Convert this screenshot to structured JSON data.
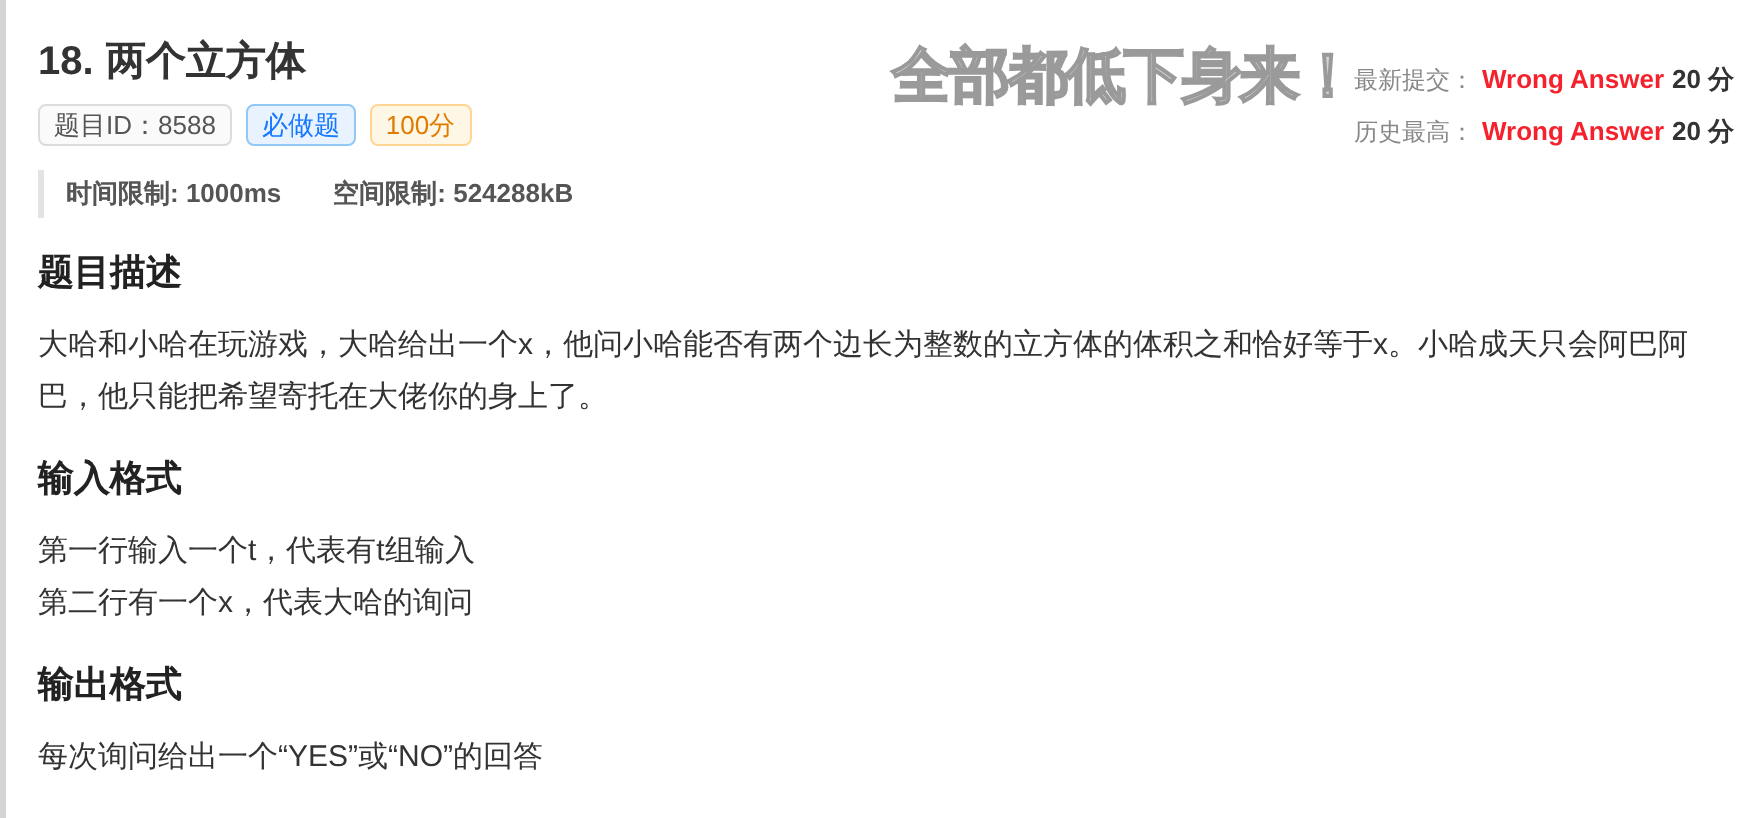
{
  "problem": {
    "number": "18.",
    "title": "两个立方体",
    "tags": [
      {
        "kind": "id",
        "label": "题目ID：8588"
      },
      {
        "kind": "required",
        "label": "必做题"
      },
      {
        "kind": "score",
        "label": "100分"
      }
    ],
    "limits": [
      {
        "label": "时间限制:",
        "value": "1000ms"
      },
      {
        "label": "空间限制:",
        "value": "524288kB"
      }
    ]
  },
  "overlay_caption": "全部都低下身来！",
  "submissions": [
    {
      "label": "最新提交：",
      "verdict": "Wrong Answer",
      "score": "20 分"
    },
    {
      "label": "历史最高：",
      "verdict": "Wrong Answer",
      "score": "20 分"
    }
  ],
  "sections": [
    {
      "heading": "题目描述",
      "lines": [
        "大哈和小哈在玩游戏，大哈给出一个x，他问小哈能否有两个边长为整数的立方体的体积之和恰好等于x。小哈成天只会阿巴阿巴，他只能把希望寄托在大佬你的身上了。"
      ]
    },
    {
      "heading": "输入格式",
      "lines": [
        "第一行输入一个t，代表有t组输入",
        "第二行有一个x，代表大哈的询问"
      ]
    },
    {
      "heading": "输出格式",
      "lines": [
        "每次询问给出一个“YES”或“NO”的回答"
      ]
    }
  ]
}
